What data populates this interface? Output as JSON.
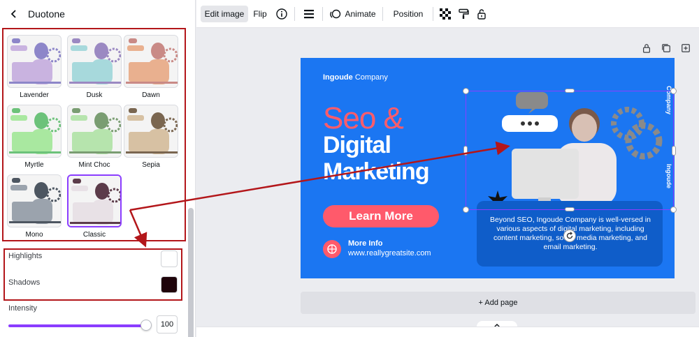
{
  "panel": {
    "title": "Duotone",
    "presets": [
      {
        "name": "Lavender",
        "tint": "#c9b3e0",
        "tint2": "#8d86c9"
      },
      {
        "name": "Dusk",
        "tint": "#a7d9dc",
        "tint2": "#9b89c2"
      },
      {
        "name": "Dawn",
        "tint": "#e9b08f",
        "tint2": "#c98a86"
      },
      {
        "name": "Myrtle",
        "tint": "#a9e8a0",
        "tint2": "#6cc27a"
      },
      {
        "name": "Mint Choc",
        "tint": "#b6e4ad",
        "tint2": "#7a9d72"
      },
      {
        "name": "Sepia",
        "tint": "#d7c1a3",
        "tint2": "#7a6650"
      },
      {
        "name": "Mono",
        "tint": "#9ba3ad",
        "tint2": "#4d5661"
      },
      {
        "name": "Classic",
        "tint": "#e8e1e6",
        "tint2": "#5c3c4a"
      }
    ],
    "selected_preset": "Classic",
    "highlights_label": "Highlights",
    "highlights_color": "#ffffff",
    "shadows_label": "Shadows",
    "shadows_color": "#1f040b",
    "intensity_label": "Intensity",
    "intensity_value": "100"
  },
  "toolbar": {
    "edit_image": "Edit image",
    "flip": "Flip",
    "animate": "Animate",
    "position": "Position"
  },
  "design": {
    "brand_bold": "Ingoude",
    "brand_rest": "Company",
    "title_line1": "Seo &",
    "title_line2": "Digital",
    "title_line3": "Marketing",
    "cta": "Learn More",
    "info_title": "More Info",
    "info_url": "www.reallygreatsite.com",
    "description": "Beyond SEO, Ingoude Company is well-versed in various aspects of digital marketing, including content marketing, social media marketing, and email marketing.",
    "vertical_top": "Company",
    "vertical_bottom": "Ingoude"
  },
  "canvas": {
    "add_page": "+ Add page"
  },
  "colors": {
    "accent": "#8b3dff",
    "design_bg": "#1b76f2",
    "annotation": "#b3161a"
  }
}
